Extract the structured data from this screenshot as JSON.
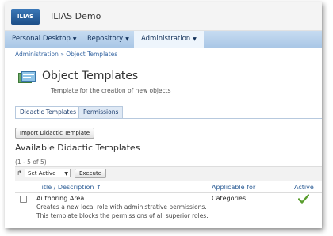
{
  "header": {
    "logo_text": "ILIAS",
    "app_title": "ILIAS Demo"
  },
  "menu": [
    {
      "label": "Personal Desktop"
    },
    {
      "label": "Repository"
    },
    {
      "label": "Administration"
    }
  ],
  "breadcrumb": {
    "parent": "Administration",
    "separator": "»",
    "current": "Object Templates"
  },
  "page": {
    "title": "Object Templates",
    "description": "Template for the creation of new objects"
  },
  "tabs": [
    {
      "label": "Didactic Templates"
    },
    {
      "label": "Permissions"
    }
  ],
  "toolbar": {
    "import_button": "Import Didactic Template"
  },
  "section": {
    "title": "Available Didactic Templates",
    "count": "(1 - 5 of 5)"
  },
  "table": {
    "bulk_action": {
      "selected": "Set Active",
      "execute_button": "Execute"
    },
    "columns": {
      "title": "Title / Description",
      "sort_indicator": "↑",
      "applicable": "Applicable for",
      "active": "Active"
    },
    "rows": [
      {
        "title": "Authoring Area",
        "description_line1": "Creates a new local role with administrative permissions.",
        "description_line2": "This template blocks the permissions of all superior roles.",
        "applicable_for": "Categories",
        "active": "check-icon"
      }
    ]
  },
  "colors": {
    "accent": "#2c5d96",
    "menu_bg": "#b8d2ec",
    "check": "#5a9e2f"
  }
}
